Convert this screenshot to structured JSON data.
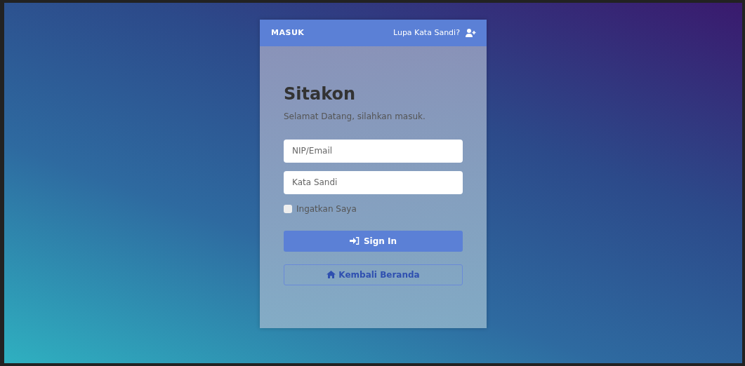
{
  "header": {
    "title": "MASUK",
    "link": "Lupa Kata Sandi?"
  },
  "app_title": "Sitakon",
  "subtitle": "Selamat Datang, silahkan masuk.",
  "fields": [
    {
      "placeholder": "NIP/Email"
    },
    {
      "placeholder": "Kata Sandi"
    }
  ],
  "remember": {
    "label": "Ingatkan Saya",
    "checked": false
  },
  "buttons": [
    {
      "label": "Sign In",
      "kind": "primary"
    },
    {
      "label": "Kembali Beranda",
      "kind": "outline"
    }
  ]
}
